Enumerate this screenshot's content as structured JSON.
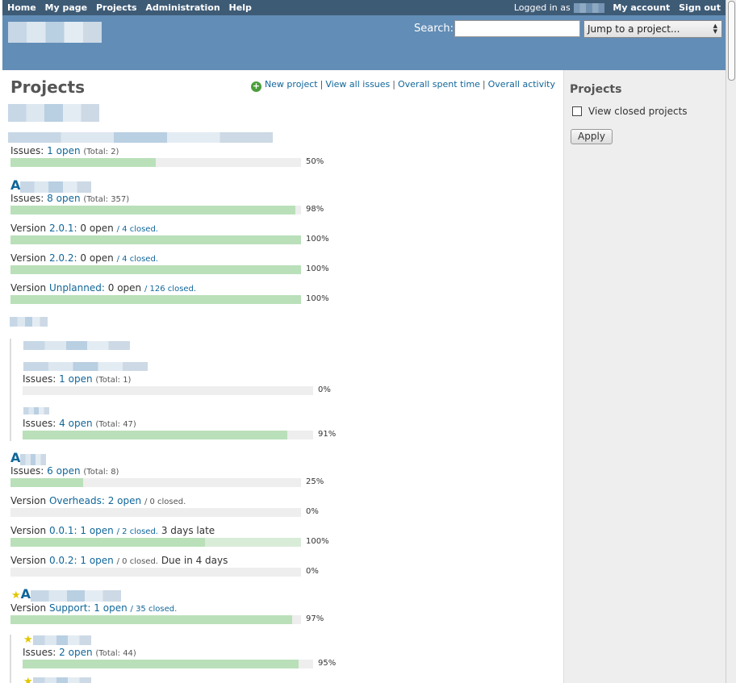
{
  "top_menu": {
    "items": [
      "Home",
      "My page",
      "Projects",
      "Administration",
      "Help"
    ],
    "logged_as_label": "Logged in as",
    "account": "My account",
    "signout": "Sign out"
  },
  "header": {
    "search_label": "Search:",
    "search_value": "",
    "jump_label": "Jump to a project..."
  },
  "content": {
    "title": "Projects",
    "actions": {
      "new_project": "New project",
      "view_all_issues": "View all issues",
      "spent_time": "Overall spent time",
      "activity": "Overall activity"
    }
  },
  "sidebar": {
    "title": "Projects",
    "closed_label": "View closed projects",
    "apply": "Apply"
  },
  "progress": {
    "p1": 50,
    "p2": 98,
    "v201": 100,
    "v202": 100,
    "vunplanned": 100,
    "sub1": 0,
    "sub2": 91,
    "p4": 25,
    "voverheads": 0,
    "v001": 100,
    "v001_late": 100,
    "v002": 0,
    "vsupport": 97,
    "sub3": 95
  },
  "projects": {
    "p1": {
      "issues_prefix": "Issues:",
      "open": "1 open",
      "total": "(Total: 2)",
      "pct": "50%"
    },
    "p2": {
      "name_prefix": "A",
      "issues_prefix": "Issues:",
      "open": "8 open",
      "total": "(Total: 357)",
      "pct": "98%",
      "versions": [
        {
          "prefix": "Version",
          "name": "2.0.1:",
          "open": "0 open",
          "closed": "/ 4 closed.",
          "pct": "100%"
        },
        {
          "prefix": "Version",
          "name": "2.0.2:",
          "open": "0 open",
          "closed": "/ 4 closed.",
          "pct": "100%"
        },
        {
          "prefix": "Version",
          "name": "Unplanned:",
          "open": "0 open",
          "closed": "/ 126 closed.",
          "pct": "100%"
        }
      ]
    },
    "sub1": {
      "issues_prefix": "Issues:",
      "open": "1 open",
      "total": "(Total: 1)",
      "pct": "0%"
    },
    "sub2": {
      "issues_prefix": "Issues:",
      "open": "4 open",
      "total": "(Total: 47)",
      "pct": "91%"
    },
    "p4": {
      "name_prefix": "A",
      "issues_prefix": "Issues:",
      "open": "6 open",
      "total": "(Total: 8)",
      "pct": "25%",
      "versions": [
        {
          "prefix": "Version",
          "name": "Overheads:",
          "open": "2 open",
          "closed": "/ 0 closed.",
          "extra": "",
          "pct": "0%"
        },
        {
          "prefix": "Version",
          "name": "0.0.1:",
          "open": "1 open",
          "closed": "/ 2 closed.",
          "extra": "3 days late",
          "pct": "100%"
        },
        {
          "prefix": "Version",
          "name": "0.0.2:",
          "open": "1 open",
          "closed": "/ 0 closed.",
          "extra": "Due in 4 days",
          "pct": "0%"
        }
      ]
    },
    "p5": {
      "name_prefix": "A",
      "version": {
        "prefix": "Version",
        "name": "Support:",
        "open": "1 open",
        "closed": "/ 35 closed.",
        "pct": "97%"
      }
    },
    "sub3": {
      "issues_prefix": "Issues:",
      "open": "2 open",
      "total": "(Total: 44)",
      "pct": "95%"
    }
  }
}
